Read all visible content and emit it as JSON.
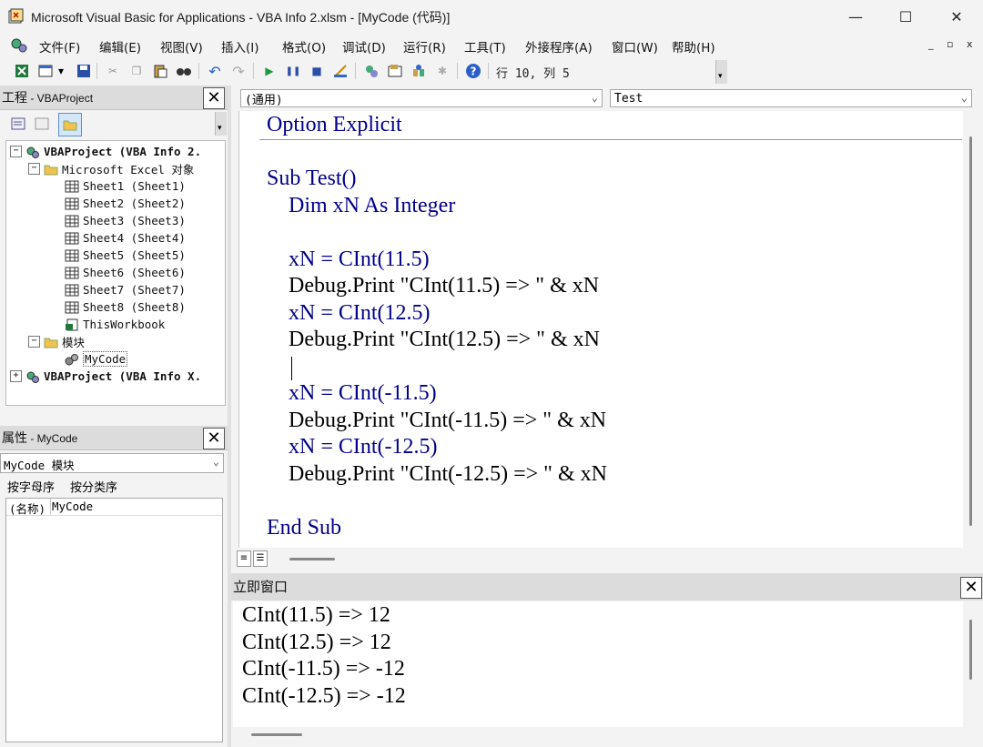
{
  "window": {
    "title": "Microsoft Visual Basic for Applications - VBA Info 2.xlsm - [MyCode (代码)]",
    "minimize": "—",
    "maximize": "☐",
    "close": "✕"
  },
  "menu": {
    "items": [
      "文件(F)",
      "编辑(E)",
      "视图(V)",
      "插入(I)",
      "格式(O)",
      "调试(D)",
      "运行(R)",
      "工具(T)",
      "外接程序(A)",
      "窗口(W)",
      "帮助(H)"
    ],
    "mdi": [
      "_",
      "▫",
      "x"
    ]
  },
  "toolbar": {
    "position": "行 10, 列 5"
  },
  "project_panel": {
    "title": "工程",
    "subtitle": " - VBAProject",
    "tree": [
      {
        "label": "VBAProject (VBA Info 2.",
        "level": 0,
        "toggle": "−",
        "icon": "project-icon"
      },
      {
        "label": "Microsoft Excel 对象",
        "level": 1,
        "toggle": "−",
        "icon": "folder-icon"
      },
      {
        "label": "Sheet1 (Sheet1)",
        "level": 2,
        "icon": "sheet-icon"
      },
      {
        "label": "Sheet2 (Sheet2)",
        "level": 2,
        "icon": "sheet-icon"
      },
      {
        "label": "Sheet3 (Sheet3)",
        "level": 2,
        "icon": "sheet-icon"
      },
      {
        "label": "Sheet4 (Sheet4)",
        "level": 2,
        "icon": "sheet-icon"
      },
      {
        "label": "Sheet5 (Sheet5)",
        "level": 2,
        "icon": "sheet-icon"
      },
      {
        "label": "Sheet6 (Sheet6)",
        "level": 2,
        "icon": "sheet-icon"
      },
      {
        "label": "Sheet7 (Sheet7)",
        "level": 2,
        "icon": "sheet-icon"
      },
      {
        "label": "Sheet8 (Sheet8)",
        "level": 2,
        "icon": "sheet-icon"
      },
      {
        "label": "ThisWorkbook",
        "level": 2,
        "icon": "workbook-icon"
      },
      {
        "label": "模块",
        "level": 1,
        "toggle": "−",
        "icon": "folder-icon"
      },
      {
        "label": "MyCode",
        "level": 2,
        "icon": "module-icon"
      },
      {
        "label": "VBAProject (VBA Info X.",
        "level": 0,
        "toggle": "+",
        "icon": "project-icon"
      }
    ]
  },
  "properties_panel": {
    "title": "属性",
    "subtitle": " - MyCode",
    "object": "MyCode 模块",
    "tabs": [
      "按字母序",
      "按分类序"
    ],
    "rows": [
      {
        "name": "(名称)",
        "value": "MyCode"
      }
    ]
  },
  "code_window": {
    "object_combo": "(通用)",
    "proc_combo": "Test",
    "lines": [
      "Option Explicit",
      "",
      "Sub Test()",
      "    Dim xN As Integer",
      "",
      "    xN = CInt(11.5)",
      "    Debug.Print \"CInt(11.5) => \" & xN",
      "    xN = CInt(12.5)",
      "    Debug.Print \"CInt(12.5) => \" & xN",
      "",
      "    xN = CInt(-11.5)",
      "    Debug.Print \"CInt(-11.5) => \" & xN",
      "    xN = CInt(-12.5)",
      "    Debug.Print \"CInt(-12.5) => \" & xN",
      "",
      "End Sub"
    ]
  },
  "immediate_window": {
    "title": "立即窗口",
    "lines": [
      "CInt(11.5) => 12",
      "CInt(12.5) => 12",
      "CInt(-11.5) => -12",
      "CInt(-12.5) => -12"
    ]
  },
  "colors": {
    "keyword": "#00008b",
    "code_text": "#000000",
    "panel_title": "#dcdcdc",
    "background": "#f3f3f3"
  }
}
